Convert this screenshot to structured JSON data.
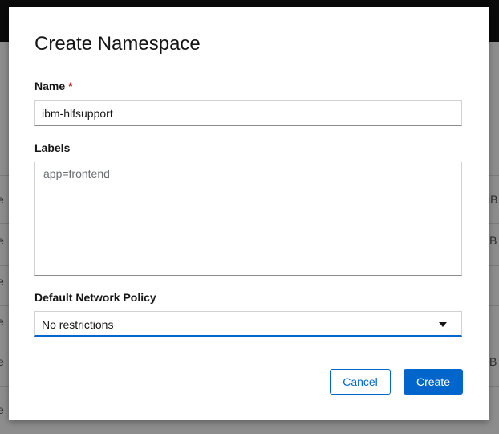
{
  "modal": {
    "title": "Create Namespace",
    "name_field": {
      "label": "Name",
      "required_marker": "*",
      "value": "ibm-hlfsupport"
    },
    "labels_field": {
      "label": "Labels",
      "placeholder": "app=frontend"
    },
    "network_policy_field": {
      "label": "Default Network Policy",
      "selected": "No restrictions"
    },
    "buttons": {
      "cancel": "Cancel",
      "create": "Create"
    }
  },
  "background": {
    "row_fragments": [
      "e",
      "e",
      "e",
      "e",
      "e",
      "e"
    ],
    "right_fragments": [
      "iB",
      "iB",
      "B"
    ]
  },
  "colors": {
    "primary": "#0066cc",
    "required": "#c9190b",
    "text": "#151515",
    "overlay": "#8d8d8d"
  }
}
